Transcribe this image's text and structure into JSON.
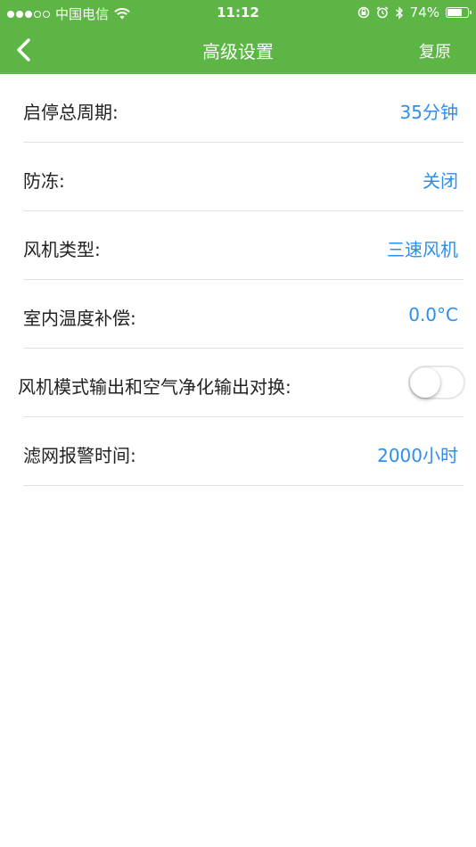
{
  "status_bar": {
    "carrier": "中国电信",
    "time": "11:12",
    "battery_percent": "74%",
    "battery_level": 0.74,
    "signal_bars_filled": 3,
    "signal_bars_total": 5
  },
  "nav": {
    "title": "高级设置",
    "back_icon": "chevron-left-icon",
    "reset_label": "复原"
  },
  "settings": [
    {
      "label": "启停总周期:",
      "value": "35分钟"
    },
    {
      "label": "防冻:",
      "value": "关闭"
    },
    {
      "label": "风机类型:",
      "value": "三速风机"
    },
    {
      "label": "室内温度补偿:",
      "value": "0.0°C"
    },
    {
      "label": "风机模式输出和空气净化输出对换:",
      "toggle_on": false
    },
    {
      "label": "滤网报警时间:",
      "value": "2000小时"
    }
  ],
  "colors": {
    "header": "#5cb544",
    "value_text": "#2e8ef0"
  }
}
